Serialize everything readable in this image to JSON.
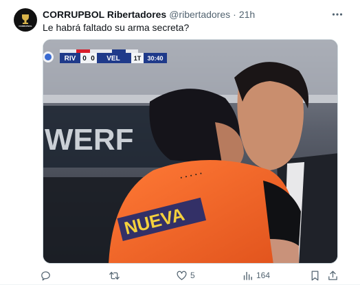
{
  "tweet": {
    "display_name": "CORRUPBOL Ribertadores",
    "handle": "@ribertadores",
    "separator": "·",
    "time": "21h",
    "text": "Le habrá faltado su arma secreta?",
    "avatar_text": "CORRUPBOL RIBERTADORES"
  },
  "media": {
    "scorebug": {
      "home": "RIV",
      "home_score": "0",
      "away_score": "0",
      "away": "VEL",
      "period": "1T",
      "clock": "30:40"
    },
    "jersey_text": "NUEVA",
    "background_text": "WERF"
  },
  "actions": {
    "replies": "",
    "retweets": "",
    "likes": "5",
    "views": "164"
  },
  "colors": {
    "text_primary": "#0f1419",
    "text_secondary": "#536471",
    "jersey_orange": "#f26a2e",
    "scorebug_blue": "#1f3a8a"
  }
}
